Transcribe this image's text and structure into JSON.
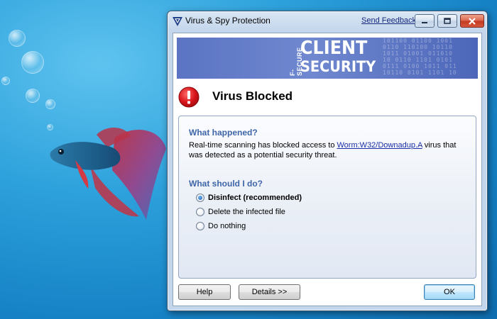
{
  "window": {
    "title": "Virus & Spy Protection",
    "feedback_link": "Send Feedback",
    "minimize_icon": "minimize-icon",
    "maximize_icon": "maximize-icon",
    "close_icon": "close-icon"
  },
  "banner": {
    "brand": "F-SECURE",
    "line1": "CLIENT",
    "line2": "SECURITY",
    "binary": "101100 01100 1001\n0110 110100 10110\n1011 01001 011010\n10 0110 1101 0101\n0111 0100 1011 011\n10110 0101 1101 10"
  },
  "alert": {
    "icon": "error-icon",
    "heading": "Virus Blocked"
  },
  "what_happened": {
    "title": "What happened?",
    "text_before": "Real-time scanning has blocked access to ",
    "virus_link": "Worm:W32/Downadup.A",
    "text_after": " virus that was detected as a potential security threat."
  },
  "what_to_do": {
    "title": "What should I do?",
    "options": [
      {
        "label": "Disinfect (recommended)",
        "checked": true
      },
      {
        "label": "Delete the infected file",
        "checked": false
      },
      {
        "label": "Do nothing",
        "checked": false
      }
    ]
  },
  "buttons": {
    "help": "Help",
    "details": "Details >>",
    "ok": "OK"
  },
  "colors": {
    "banner": "#6780c8",
    "section_title": "#3f66a8",
    "link": "#1b2ea5",
    "alert_red": "#d8141a"
  }
}
